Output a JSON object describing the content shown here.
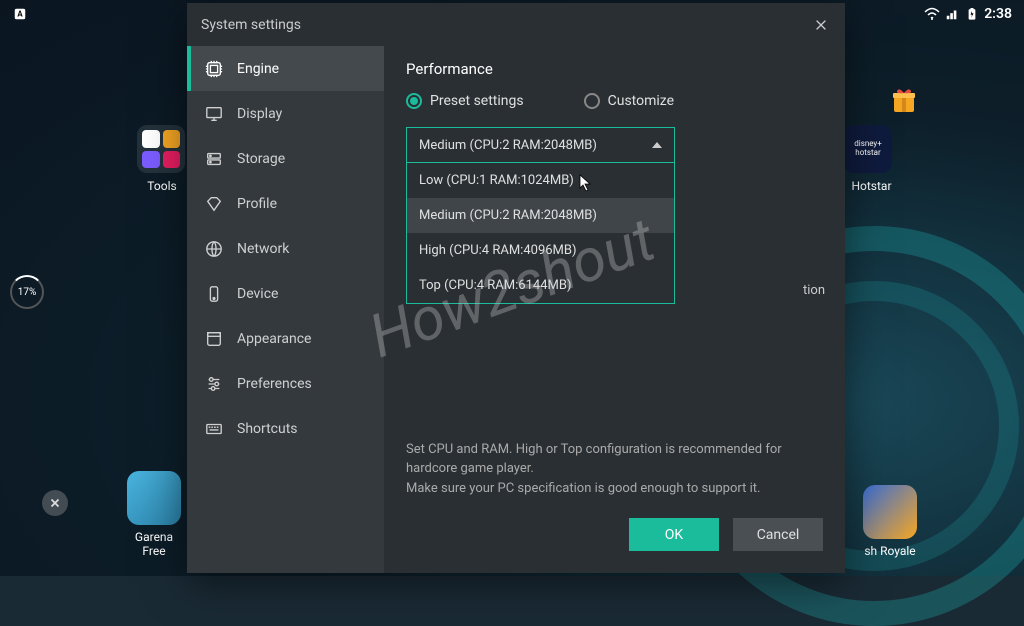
{
  "status": {
    "time": "2:38"
  },
  "desktop": {
    "tools_label": "Tools",
    "hotstar_label": "Hotstar",
    "hotstar_brand": "disney+ hotstar",
    "garena_label": "Garena Free",
    "clash_label": "sh Royale",
    "percent_indicator": "17%"
  },
  "modal": {
    "title": "System settings",
    "sidebar": {
      "items": [
        {
          "label": "Engine",
          "icon": "engine"
        },
        {
          "label": "Display",
          "icon": "display"
        },
        {
          "label": "Storage",
          "icon": "storage"
        },
        {
          "label": "Profile",
          "icon": "profile"
        },
        {
          "label": "Network",
          "icon": "network"
        },
        {
          "label": "Device",
          "icon": "device"
        },
        {
          "label": "Appearance",
          "icon": "appearance"
        },
        {
          "label": "Preferences",
          "icon": "preferences"
        },
        {
          "label": "Shortcuts",
          "icon": "shortcuts"
        }
      ],
      "active_index": 0
    },
    "content": {
      "section_title": "Performance",
      "radio_preset": "Preset settings",
      "radio_custom": "Customize",
      "dropdown_selected": "Medium (CPU:2 RAM:2048MB)",
      "dropdown_options": [
        "Low (CPU:1 RAM:1024MB)",
        "Medium (CPU:2 RAM:2048MB)",
        "High (CPU:4 RAM:4096MB)",
        "Top (CPU:4 RAM:6144MB)"
      ],
      "hidden_hint_fragment": "tion",
      "help_line1": "Set CPU and RAM. High or Top configuration is recommended for hardcore game player.",
      "help_line2": "Make sure your PC specification is good enough to support it.",
      "btn_ok": "OK",
      "btn_cancel": "Cancel"
    }
  },
  "watermark": "How2shout"
}
